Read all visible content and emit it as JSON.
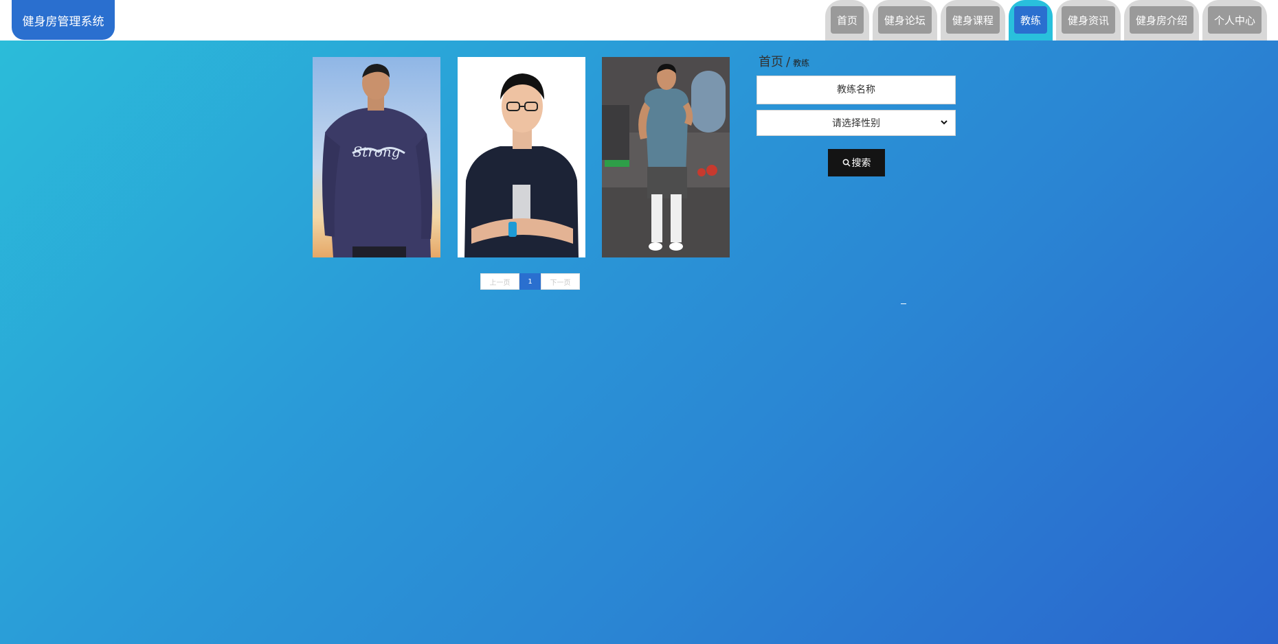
{
  "app": {
    "title": "健身房管理系统"
  },
  "nav": {
    "items": [
      {
        "label": "首页",
        "active": false
      },
      {
        "label": "健身论坛",
        "active": false
      },
      {
        "label": "健身课程",
        "active": false
      },
      {
        "label": "教练",
        "active": true
      },
      {
        "label": "健身资讯",
        "active": false
      },
      {
        "label": "健身房介绍",
        "active": false
      },
      {
        "label": "个人中心",
        "active": false
      }
    ]
  },
  "breadcrumb": {
    "home": "首页",
    "separator": "/",
    "current": "教练"
  },
  "search": {
    "name_placeholder": "教练名称",
    "gender_placeholder": "请选择性别",
    "button_label": "搜索",
    "button_icon": "search-icon"
  },
  "coaches": [
    {
      "photo": "coach-photo-1",
      "shirt_text": "Strong"
    },
    {
      "photo": "coach-photo-2"
    },
    {
      "photo": "coach-photo-3"
    }
  ],
  "pagination": {
    "prev_label": "上一页",
    "current_page": "1",
    "next_label": "下一页"
  },
  "colors": {
    "brand": "#2a6fcf",
    "nav_active_tab": "#29c0dc",
    "nav_inactive_tab": "#d8d8d8",
    "nav_inactive_pill": "#9a9a9a",
    "gradient_start": "#2bbcd9",
    "gradient_end": "#2a64cd",
    "search_button": "#141414"
  }
}
